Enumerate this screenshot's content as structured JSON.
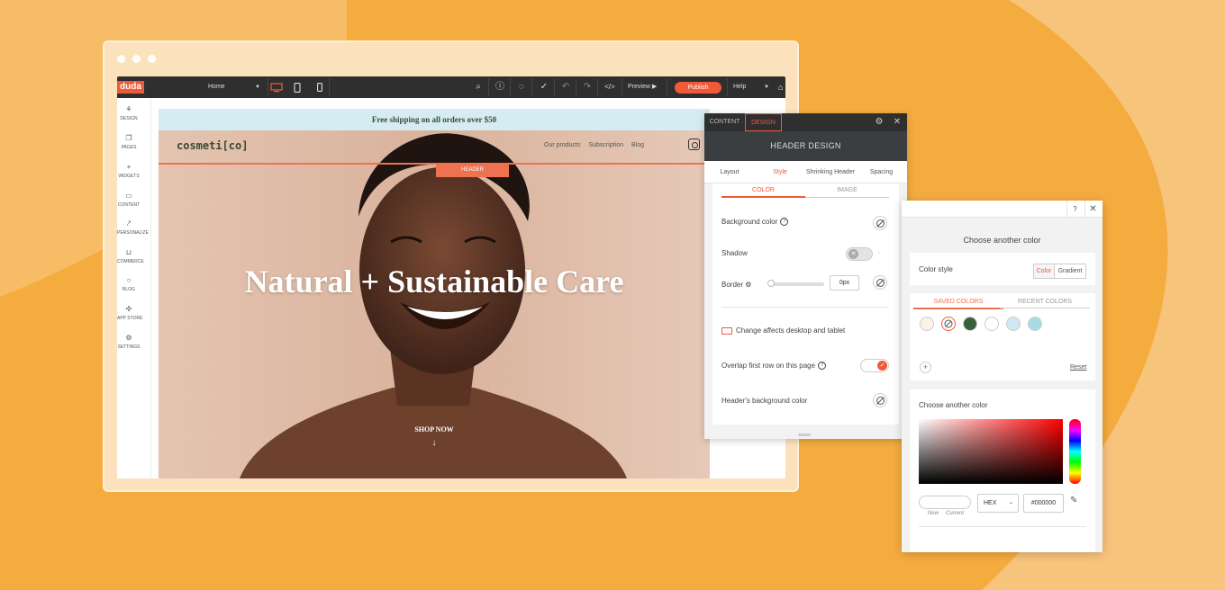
{
  "editor": {
    "brand": "duda",
    "page_select": "Home",
    "preview_label": "Preview",
    "publish_label": "Publish",
    "help_label": "Help"
  },
  "sidebar": {
    "items": [
      {
        "label": "DESIGN",
        "icon": "palette-icon"
      },
      {
        "label": "PAGES",
        "icon": "pages-icon"
      },
      {
        "label": "WIDGETS",
        "icon": "plus-icon"
      },
      {
        "label": "CONTENT",
        "icon": "folder-icon"
      },
      {
        "label": "PERSONALIZE",
        "icon": "personalize-icon"
      },
      {
        "label": "COMMERCE",
        "icon": "cart-icon"
      },
      {
        "label": "BLOG",
        "icon": "chat-icon"
      },
      {
        "label": "APP STORE",
        "icon": "puzzle-icon"
      },
      {
        "label": "SETTINGS",
        "icon": "gear-icon"
      }
    ]
  },
  "site": {
    "shipping_banner": "Free shipping on all orders over $50",
    "brand": "cosmeti[co]",
    "nav": [
      "Our products",
      "Subscription",
      "Blog"
    ],
    "header_tag": "HEADER",
    "hero_title": "Natural + Sustainable Care",
    "cta": "SHOP NOW"
  },
  "design_panel": {
    "tabs": [
      "CONTENT",
      "DESIGN"
    ],
    "active_tab": "DESIGN",
    "heading": "HEADER DESIGN",
    "subtabs": [
      "Layout",
      "Style",
      "Shrinking Header",
      "Spacing"
    ],
    "active_subtab": "Style",
    "segments": [
      "COLOR",
      "IMAGE"
    ],
    "rows": {
      "background_color": "Background color",
      "shadow": "Shadow",
      "border": "Border",
      "border_value": "0px",
      "device_note": "Change affects desktop and tablet",
      "overlap": "Overlap first row on this page",
      "header_bg": "Header's background color"
    },
    "toggles": {
      "shadow": false,
      "overlap": true
    },
    "colors": {
      "accent": "#ef5a38",
      "dark": "#2f2f30"
    }
  },
  "color_panel": {
    "title": "Choose another color",
    "color_style_label": "Color style",
    "style_options": [
      "Color",
      "Gradient"
    ],
    "active_style": "Color",
    "saved_tabs": [
      "SAVED COLORS",
      "RECENT COLORS"
    ],
    "swatches": [
      "#fbf3ea",
      "none",
      "#3b5e3b",
      "#ffffff",
      "#cfe9f2",
      "#a8dbe6"
    ],
    "reset_label": "Reset",
    "picker_label": "Choose another color",
    "new_label": "New",
    "current_label": "Current",
    "format": "HEX",
    "hex_value": "#000000"
  }
}
